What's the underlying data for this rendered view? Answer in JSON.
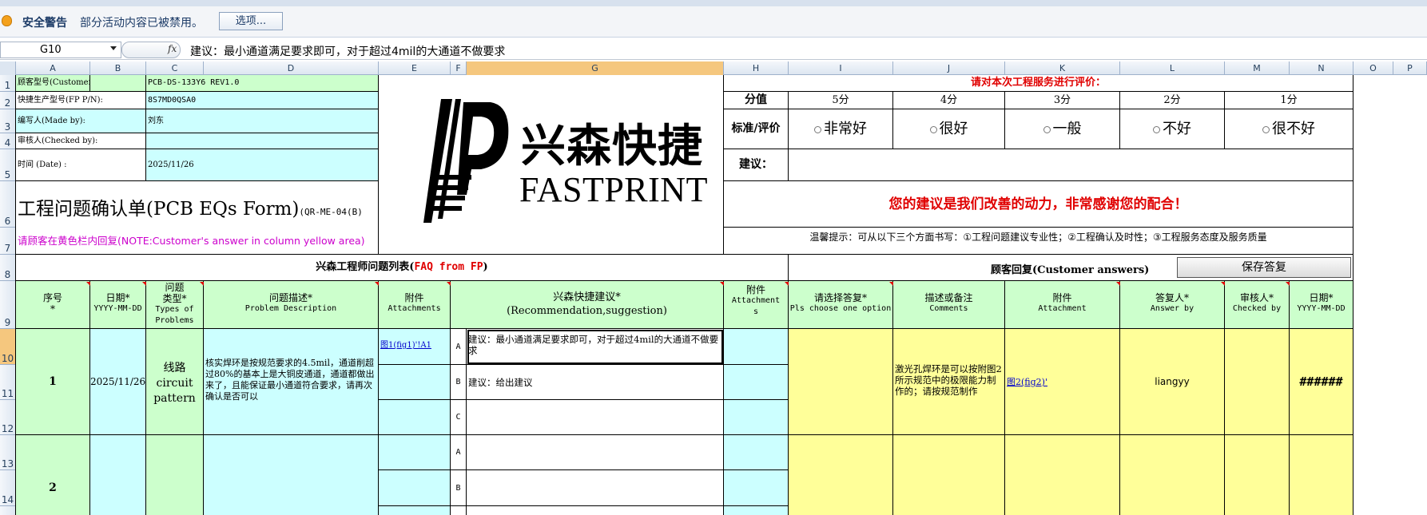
{
  "security_bar": {
    "title": "安全警告",
    "message": "部分活动内容已被禁用。",
    "options_button": "选项..."
  },
  "formula_bar": {
    "name_box": "G10",
    "fx_label": "fx",
    "formula": "建议：最小通道满足要求即可，对于超过4mil的大通道不做要求"
  },
  "columns": [
    "A",
    "B",
    "C",
    "D",
    "E",
    "F",
    "G",
    "H",
    "I",
    "J",
    "K",
    "L",
    "M",
    "N",
    "O",
    "P"
  ],
  "rows": [
    "1",
    "2",
    "3",
    "4",
    "5",
    "6",
    "7",
    "8",
    "9",
    "10",
    "11",
    "12",
    "13",
    "14"
  ],
  "info": {
    "customer_pn_label": "顾客型号(Customer P/N):",
    "customer_pn_value": "PCB-DS-133Y6 REV1.0",
    "fp_pn_label": "快捷生产型号(FP P/N):",
    "fp_pn_value": "8S7MD0QSA0",
    "made_by_label": "编写人(Made by):",
    "made_by_value": "刘东",
    "checked_by_label": "审核人(Checked by):",
    "checked_by_value": "",
    "date_label": "时间 (Date) :",
    "date_value": "2025/11/26"
  },
  "form_title": "工程问题确认单(PCB EQs Form)",
  "form_code": "(QR-ME-04(B)",
  "note": "请顾客在黄色栏内回复(NOTE:Customer's answer in column yellow area)",
  "logo": {
    "cn": "兴森快捷",
    "en": "FASTPRINT"
  },
  "rating": {
    "title": "请对本次工程服务进行评价：",
    "score_label": "分值",
    "scores": [
      "5分",
      "4分",
      "3分",
      "2分",
      "1分"
    ],
    "criteria_label": "标准/评价",
    "options": [
      "非常好",
      "很好",
      "一般",
      "不好",
      "很不好"
    ],
    "suggestion_label": "建议：",
    "thanks": "您的建议是我们改善的动力，非常感谢您的配合！",
    "tip": "温馨提示：可从以下三个方面书写：①工程问题建议专业性；②工程确认及时性；③工程服务态度及服务质量"
  },
  "section": {
    "fp_title_cn": "兴森工程师问题列表(",
    "fp_title_en": "FAQ from FP",
    "fp_title_end": ")",
    "customer_title": "顾客回复(Customer answers)",
    "save_button": "保存答复"
  },
  "headers": {
    "no": [
      "序号",
      "*"
    ],
    "date": [
      "日期*",
      "YYYY-MM-DD"
    ],
    "type": [
      "问题",
      "类型*",
      "Types of",
      "Problems"
    ],
    "desc": [
      "问题描述*",
      "Problem Description"
    ],
    "attach": [
      "附件",
      "Attachments"
    ],
    "recommend": [
      "兴森快捷建议*",
      "(Recommendation,suggestion)"
    ],
    "attach2": [
      "附件",
      "Attachment",
      "s"
    ],
    "choose": [
      "请选择答复*",
      "Pls choose one option"
    ],
    "comments": [
      "描述或备注",
      "Comments"
    ],
    "attachment": [
      "附件",
      "Attachment"
    ],
    "answer_by": [
      "答复人*",
      "Answer by"
    ],
    "checked_by": [
      "审核人*",
      "Checked by"
    ],
    "date2": [
      "日期*",
      "YYYY-MM-DD"
    ]
  },
  "items": [
    {
      "no": "1",
      "date": "2025/11/26",
      "type": [
        "线路",
        "circuit",
        "pattern"
      ],
      "desc": "核实焊环是按规范要求的4.5mil，通道削超过80%的基本上是大铜皮通道，通道都做出来了，且能保证最小通道符合要求，请再次确认是否可以",
      "attach": "图1(fig1)'!A1",
      "options": [
        {
          "letter": "A",
          "text": "建议：最小通道满足要求即可，对于超过4mil的大通道不做要求"
        },
        {
          "letter": "B",
          "text": "建议：给出建议"
        },
        {
          "letter": "C",
          "text": ""
        }
      ],
      "comments": "激光孔焊环是可以按附图2所示规范中的极限能力制作的；请按规范制作",
      "attachment": "图2(fig2)'",
      "answer_by": "liangyy",
      "checked_by": "",
      "date2": "######"
    },
    {
      "no": "2",
      "options": [
        {
          "letter": "A",
          "text": ""
        },
        {
          "letter": "B",
          "text": ""
        }
      ]
    }
  ]
}
